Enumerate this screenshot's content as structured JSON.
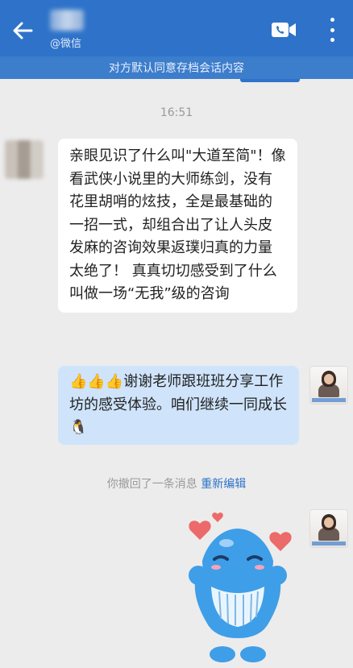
{
  "header": {
    "source_label": "@微信",
    "back_icon": "back-arrow-icon",
    "video_icon": "video-call-icon",
    "more_icon": "more-vertical-icon",
    "background": "#2e73c9"
  },
  "notice": "对方默认同意存档会话内容",
  "time": "16:51",
  "messages": {
    "incoming_text": "亲眼见识了什么叫\"大道至简\"！像看武侠小说里的大师练剑，没有花里胡哨的炫技，全是最基础的一招一式，却组合出了让人头皮发麻的咨询效果返璞归真的力量太绝了！ 真真切切感受到了什么叫做一场“无我”级的咨询",
    "outgoing_text": "谢谢老师跟班班分享工作坊的感受体验。咱们继续一同成长",
    "outgoing_emoji": "👍👍👍",
    "outgoing_tail_emoji": "🐧"
  },
  "recall": {
    "text": "你撤回了一条消息",
    "action": "重新编辑"
  },
  "sticker_icon": "blue-whale-hearts-sticker"
}
